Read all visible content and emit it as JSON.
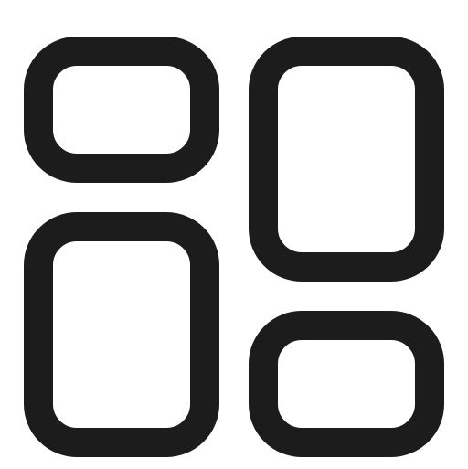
{
  "icon": {
    "name": "dashboard-grid-icon",
    "stroke_color": "#1c1c1c",
    "background_color": "#ffffff"
  }
}
